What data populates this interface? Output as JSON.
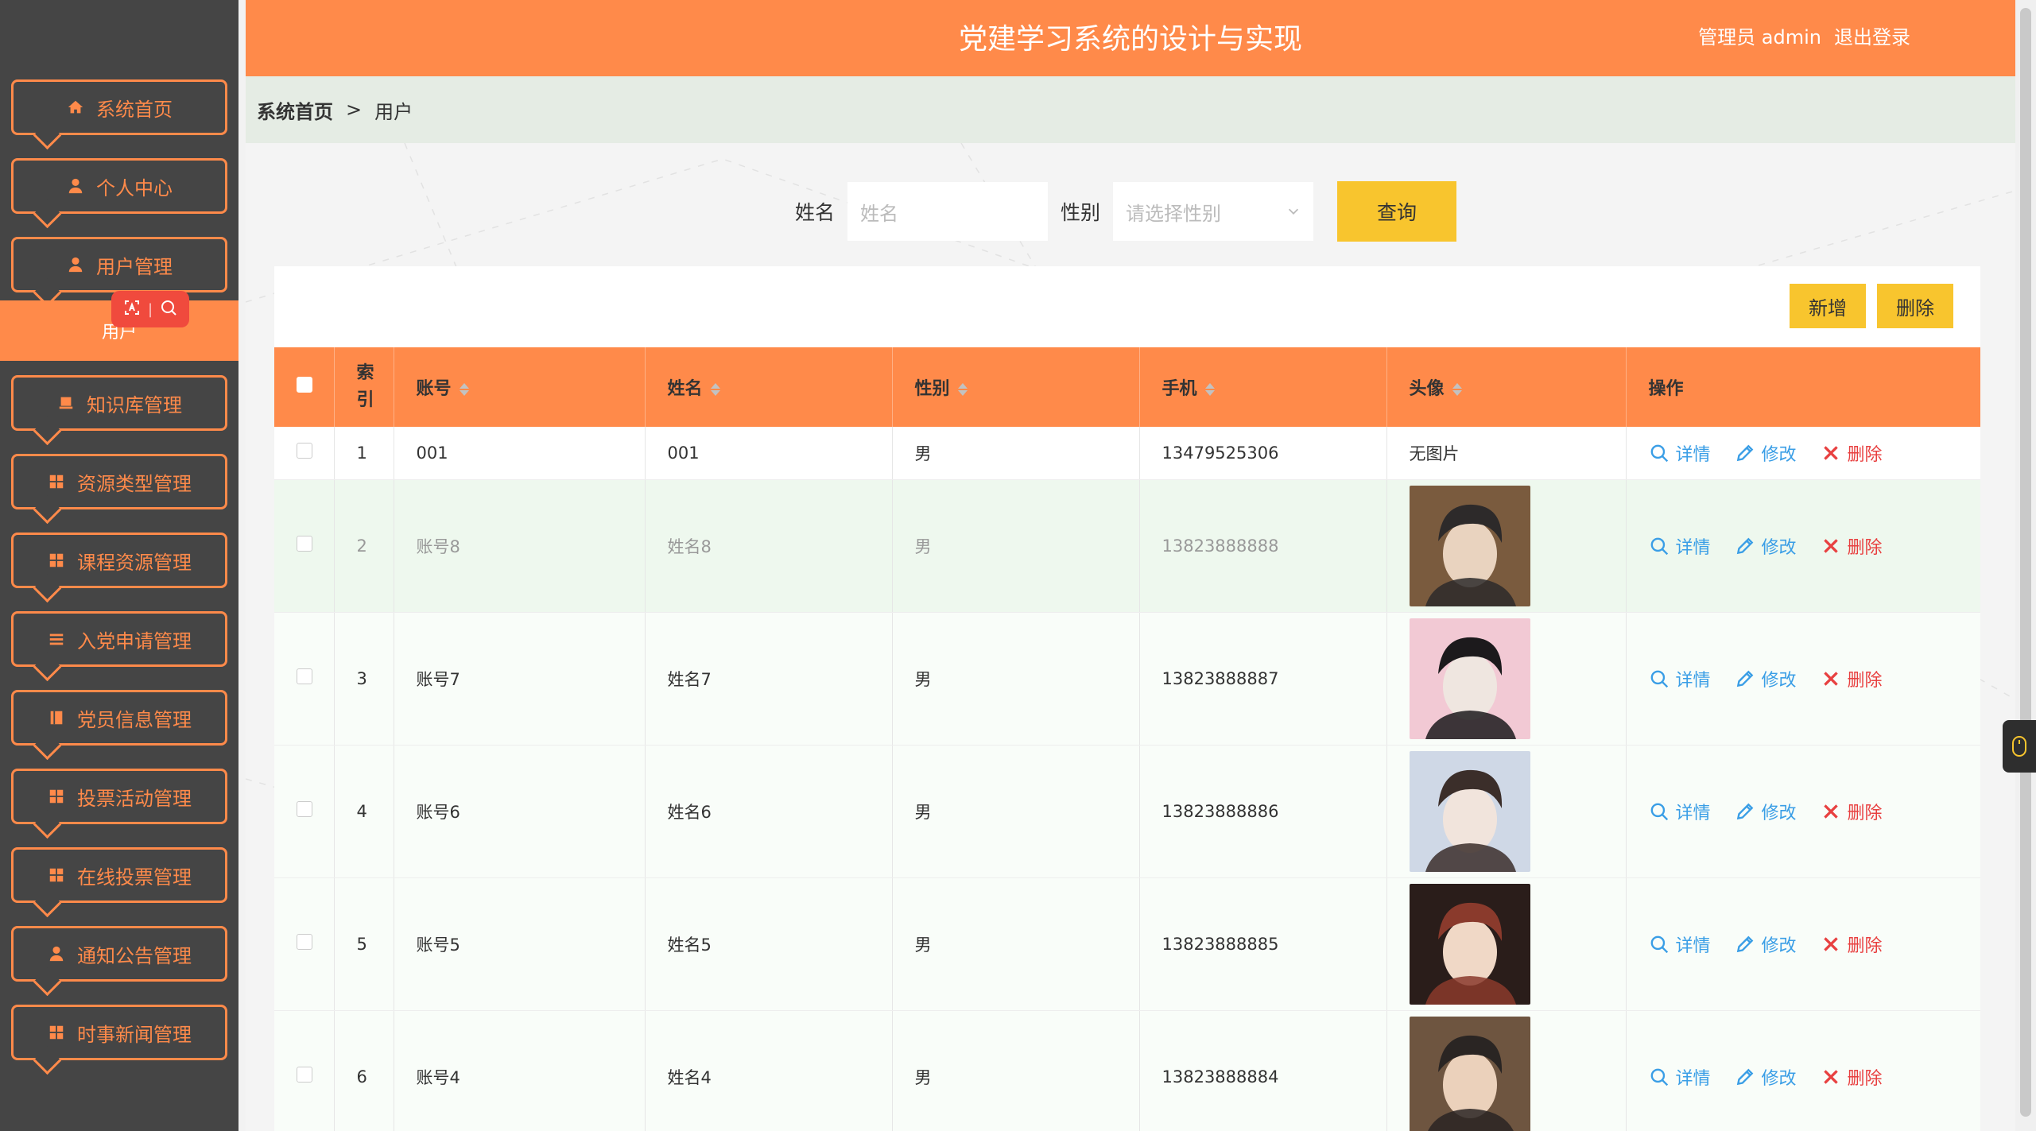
{
  "header": {
    "title": "党建学习系统的设计与实现",
    "user_label": "管理员 admin",
    "logout": "退出登录"
  },
  "breadcrumb": {
    "home": "系统首页",
    "sep": ">",
    "current": "用户"
  },
  "sidebar": {
    "items": [
      {
        "label": "系统首页",
        "icon": "home-icon"
      },
      {
        "label": "个人中心",
        "icon": "user-icon"
      },
      {
        "label": "用户管理",
        "icon": "user-icon"
      },
      {
        "label": "知识库管理",
        "icon": "book-icon"
      },
      {
        "label": "资源类型管理",
        "icon": "grid-icon"
      },
      {
        "label": "课程资源管理",
        "icon": "grid-icon"
      },
      {
        "label": "入党申请管理",
        "icon": "list-icon"
      },
      {
        "label": "党员信息管理",
        "icon": "book-icon"
      },
      {
        "label": "投票活动管理",
        "icon": "grid-icon"
      },
      {
        "label": "在线投票管理",
        "icon": "grid-icon"
      },
      {
        "label": "通知公告管理",
        "icon": "user-icon"
      },
      {
        "label": "时事新闻管理",
        "icon": "grid-icon"
      }
    ],
    "submenu": {
      "label": "用户"
    }
  },
  "search": {
    "name_label": "姓名",
    "name_placeholder": "姓名",
    "gender_label": "性别",
    "gender_placeholder": "请选择性别",
    "query_button": "查询"
  },
  "actions": {
    "add": "新增",
    "delete": "删除"
  },
  "table": {
    "columns": [
      "索引",
      "账号",
      "姓名",
      "性别",
      "手机",
      "头像",
      "操作"
    ],
    "op_labels": {
      "detail": "详情",
      "edit": "修改",
      "delete": "删除"
    },
    "no_image": "无图片",
    "rows": [
      {
        "index": "1",
        "account": "001",
        "name": "001",
        "gender": "男",
        "phone": "13479525306",
        "avatar": null
      },
      {
        "index": "2",
        "account": "账号8",
        "name": "姓名8",
        "gender": "男",
        "phone": "13823888888",
        "avatar": "photo-1"
      },
      {
        "index": "3",
        "account": "账号7",
        "name": "姓名7",
        "gender": "男",
        "phone": "13823888887",
        "avatar": "photo-2"
      },
      {
        "index": "4",
        "account": "账号6",
        "name": "姓名6",
        "gender": "男",
        "phone": "13823888886",
        "avatar": "photo-3"
      },
      {
        "index": "5",
        "account": "账号5",
        "name": "姓名5",
        "gender": "男",
        "phone": "13823888885",
        "avatar": "photo-4"
      },
      {
        "index": "6",
        "account": "账号4",
        "name": "姓名4",
        "gender": "男",
        "phone": "13823888884",
        "avatar": "photo-5"
      }
    ]
  },
  "colors": {
    "accent": "#ff8a4a",
    "sidebar_bg": "#454545",
    "button_yellow": "#f8c52e",
    "link_blue": "#3a9ee6",
    "danger_red": "#e84040"
  }
}
